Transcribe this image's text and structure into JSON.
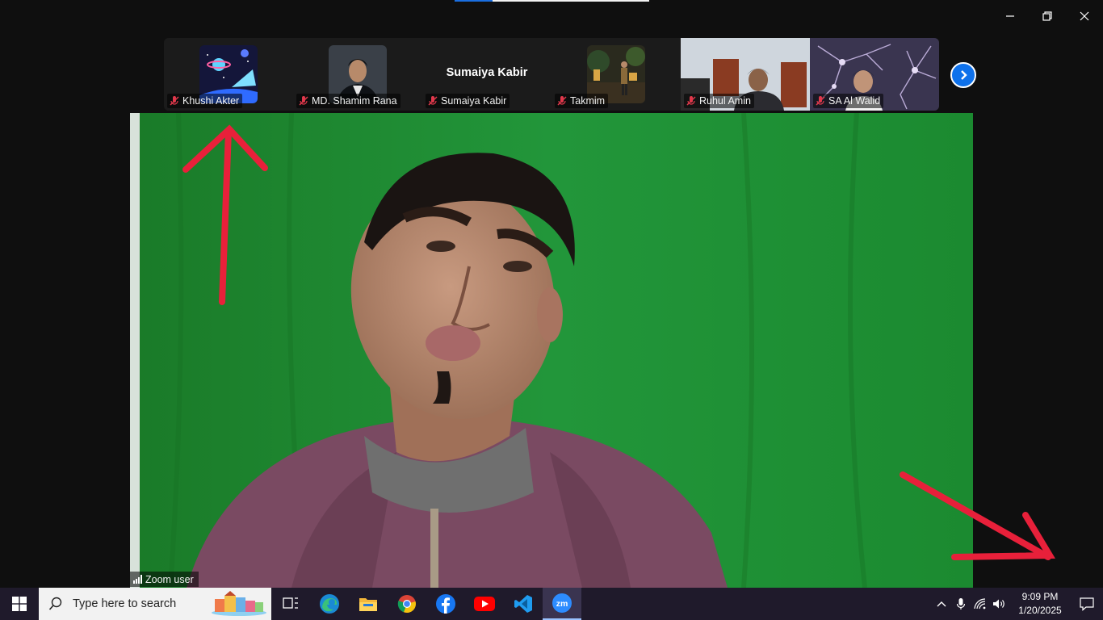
{
  "window": {
    "controls": [
      {
        "name": "minimize",
        "icon": "minimize-icon"
      },
      {
        "name": "restore",
        "icon": "restore-icon"
      },
      {
        "name": "close",
        "icon": "close-icon"
      }
    ]
  },
  "participants": [
    {
      "name": "Khushi Akter",
      "muted": true,
      "view": "avatar-space"
    },
    {
      "name": "MD. Shamim Rana",
      "muted": true,
      "view": "avatar-portrait"
    },
    {
      "name": "Sumaiya Kabir",
      "muted": true,
      "view": "name-only",
      "display_name": "Sumaiya Kabir"
    },
    {
      "name": "Takmim",
      "muted": true,
      "view": "avatar-street"
    },
    {
      "name": "Ruhul Amin",
      "muted": true,
      "view": "video"
    },
    {
      "name": "SA Al Walid",
      "muted": true,
      "view": "video"
    }
  ],
  "strip": {
    "next_icon": "chevron-right-icon"
  },
  "main_video": {
    "label": "Zoom user",
    "signal_icon": "signal-bars-icon"
  },
  "taskbar": {
    "search_placeholder": "Type here to search",
    "apps": [
      "task-view",
      "edge",
      "file-explorer",
      "chrome",
      "facebook",
      "youtube",
      "vscode",
      "zoom"
    ],
    "active_app": "zoom",
    "zoom_label": "zm",
    "time": "9:09 PM",
    "date": "1/20/2025"
  },
  "colors": {
    "accent": "#0e71eb",
    "annotation": "#e8203a",
    "greenscreen": "#1d8c2e",
    "taskbar": "#1f1a2b"
  }
}
